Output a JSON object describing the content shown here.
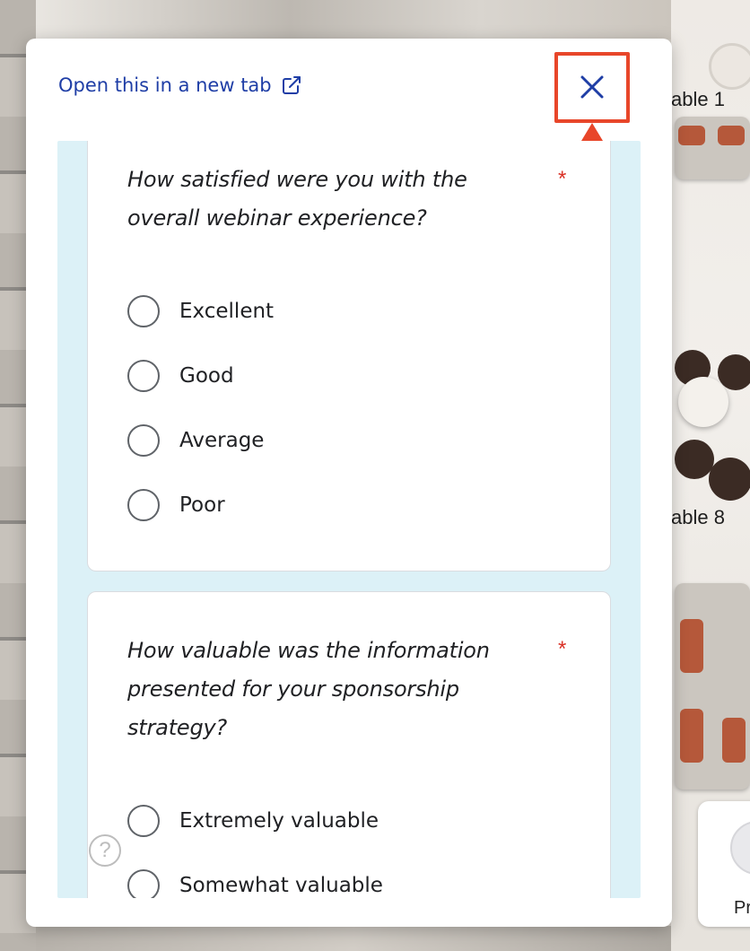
{
  "background": {
    "table_labels": [
      "able 1",
      "able 8"
    ],
    "profile_card_label": "Pr"
  },
  "modal": {
    "open_link_label": "Open this in a new tab",
    "open_link_icon": "external-link-icon",
    "close_icon": "close-icon",
    "highlight_color": "#e8462a"
  },
  "form": {
    "questions": [
      {
        "text": "How satisfied were you with the overall webinar experience?",
        "required_mark": "*",
        "options": [
          "Excellent",
          "Good",
          "Average",
          "Poor"
        ]
      },
      {
        "text": "How valuable was the information presented for your sponsorship strategy?",
        "required_mark": "*",
        "options": [
          "Extremely valuable",
          "Somewhat valuable"
        ]
      }
    ],
    "help_icon_glyph": "?"
  },
  "colors": {
    "link": "#1f3ea6",
    "required": "#d93025",
    "form_background": "#dcf1f7"
  }
}
